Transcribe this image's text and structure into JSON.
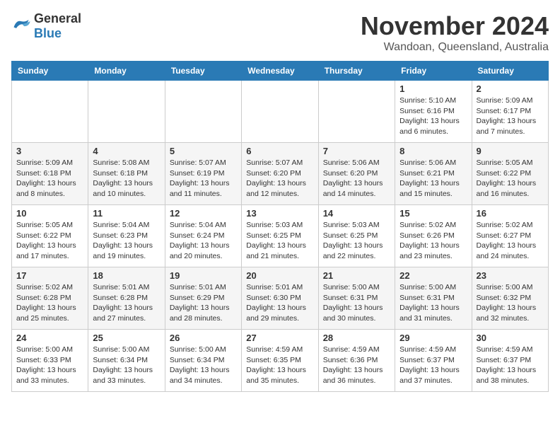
{
  "header": {
    "logo": {
      "general": "General",
      "blue": "Blue"
    },
    "month": "November 2024",
    "location": "Wandoan, Queensland, Australia"
  },
  "days_of_week": [
    "Sunday",
    "Monday",
    "Tuesday",
    "Wednesday",
    "Thursday",
    "Friday",
    "Saturday"
  ],
  "weeks": [
    [
      {
        "day": "",
        "info": ""
      },
      {
        "day": "",
        "info": ""
      },
      {
        "day": "",
        "info": ""
      },
      {
        "day": "",
        "info": ""
      },
      {
        "day": "",
        "info": ""
      },
      {
        "day": "1",
        "info": "Sunrise: 5:10 AM\nSunset: 6:16 PM\nDaylight: 13 hours\nand 6 minutes."
      },
      {
        "day": "2",
        "info": "Sunrise: 5:09 AM\nSunset: 6:17 PM\nDaylight: 13 hours\nand 7 minutes."
      }
    ],
    [
      {
        "day": "3",
        "info": "Sunrise: 5:09 AM\nSunset: 6:18 PM\nDaylight: 13 hours\nand 8 minutes."
      },
      {
        "day": "4",
        "info": "Sunrise: 5:08 AM\nSunset: 6:18 PM\nDaylight: 13 hours\nand 10 minutes."
      },
      {
        "day": "5",
        "info": "Sunrise: 5:07 AM\nSunset: 6:19 PM\nDaylight: 13 hours\nand 11 minutes."
      },
      {
        "day": "6",
        "info": "Sunrise: 5:07 AM\nSunset: 6:20 PM\nDaylight: 13 hours\nand 12 minutes."
      },
      {
        "day": "7",
        "info": "Sunrise: 5:06 AM\nSunset: 6:20 PM\nDaylight: 13 hours\nand 14 minutes."
      },
      {
        "day": "8",
        "info": "Sunrise: 5:06 AM\nSunset: 6:21 PM\nDaylight: 13 hours\nand 15 minutes."
      },
      {
        "day": "9",
        "info": "Sunrise: 5:05 AM\nSunset: 6:22 PM\nDaylight: 13 hours\nand 16 minutes."
      }
    ],
    [
      {
        "day": "10",
        "info": "Sunrise: 5:05 AM\nSunset: 6:22 PM\nDaylight: 13 hours\nand 17 minutes."
      },
      {
        "day": "11",
        "info": "Sunrise: 5:04 AM\nSunset: 6:23 PM\nDaylight: 13 hours\nand 19 minutes."
      },
      {
        "day": "12",
        "info": "Sunrise: 5:04 AM\nSunset: 6:24 PM\nDaylight: 13 hours\nand 20 minutes."
      },
      {
        "day": "13",
        "info": "Sunrise: 5:03 AM\nSunset: 6:25 PM\nDaylight: 13 hours\nand 21 minutes."
      },
      {
        "day": "14",
        "info": "Sunrise: 5:03 AM\nSunset: 6:25 PM\nDaylight: 13 hours\nand 22 minutes."
      },
      {
        "day": "15",
        "info": "Sunrise: 5:02 AM\nSunset: 6:26 PM\nDaylight: 13 hours\nand 23 minutes."
      },
      {
        "day": "16",
        "info": "Sunrise: 5:02 AM\nSunset: 6:27 PM\nDaylight: 13 hours\nand 24 minutes."
      }
    ],
    [
      {
        "day": "17",
        "info": "Sunrise: 5:02 AM\nSunset: 6:28 PM\nDaylight: 13 hours\nand 25 minutes."
      },
      {
        "day": "18",
        "info": "Sunrise: 5:01 AM\nSunset: 6:28 PM\nDaylight: 13 hours\nand 27 minutes."
      },
      {
        "day": "19",
        "info": "Sunrise: 5:01 AM\nSunset: 6:29 PM\nDaylight: 13 hours\nand 28 minutes."
      },
      {
        "day": "20",
        "info": "Sunrise: 5:01 AM\nSunset: 6:30 PM\nDaylight: 13 hours\nand 29 minutes."
      },
      {
        "day": "21",
        "info": "Sunrise: 5:00 AM\nSunset: 6:31 PM\nDaylight: 13 hours\nand 30 minutes."
      },
      {
        "day": "22",
        "info": "Sunrise: 5:00 AM\nSunset: 6:31 PM\nDaylight: 13 hours\nand 31 minutes."
      },
      {
        "day": "23",
        "info": "Sunrise: 5:00 AM\nSunset: 6:32 PM\nDaylight: 13 hours\nand 32 minutes."
      }
    ],
    [
      {
        "day": "24",
        "info": "Sunrise: 5:00 AM\nSunset: 6:33 PM\nDaylight: 13 hours\nand 33 minutes."
      },
      {
        "day": "25",
        "info": "Sunrise: 5:00 AM\nSunset: 6:34 PM\nDaylight: 13 hours\nand 33 minutes."
      },
      {
        "day": "26",
        "info": "Sunrise: 5:00 AM\nSunset: 6:34 PM\nDaylight: 13 hours\nand 34 minutes."
      },
      {
        "day": "27",
        "info": "Sunrise: 4:59 AM\nSunset: 6:35 PM\nDaylight: 13 hours\nand 35 minutes."
      },
      {
        "day": "28",
        "info": "Sunrise: 4:59 AM\nSunset: 6:36 PM\nDaylight: 13 hours\nand 36 minutes."
      },
      {
        "day": "29",
        "info": "Sunrise: 4:59 AM\nSunset: 6:37 PM\nDaylight: 13 hours\nand 37 minutes."
      },
      {
        "day": "30",
        "info": "Sunrise: 4:59 AM\nSunset: 6:37 PM\nDaylight: 13 hours\nand 38 minutes."
      }
    ]
  ]
}
